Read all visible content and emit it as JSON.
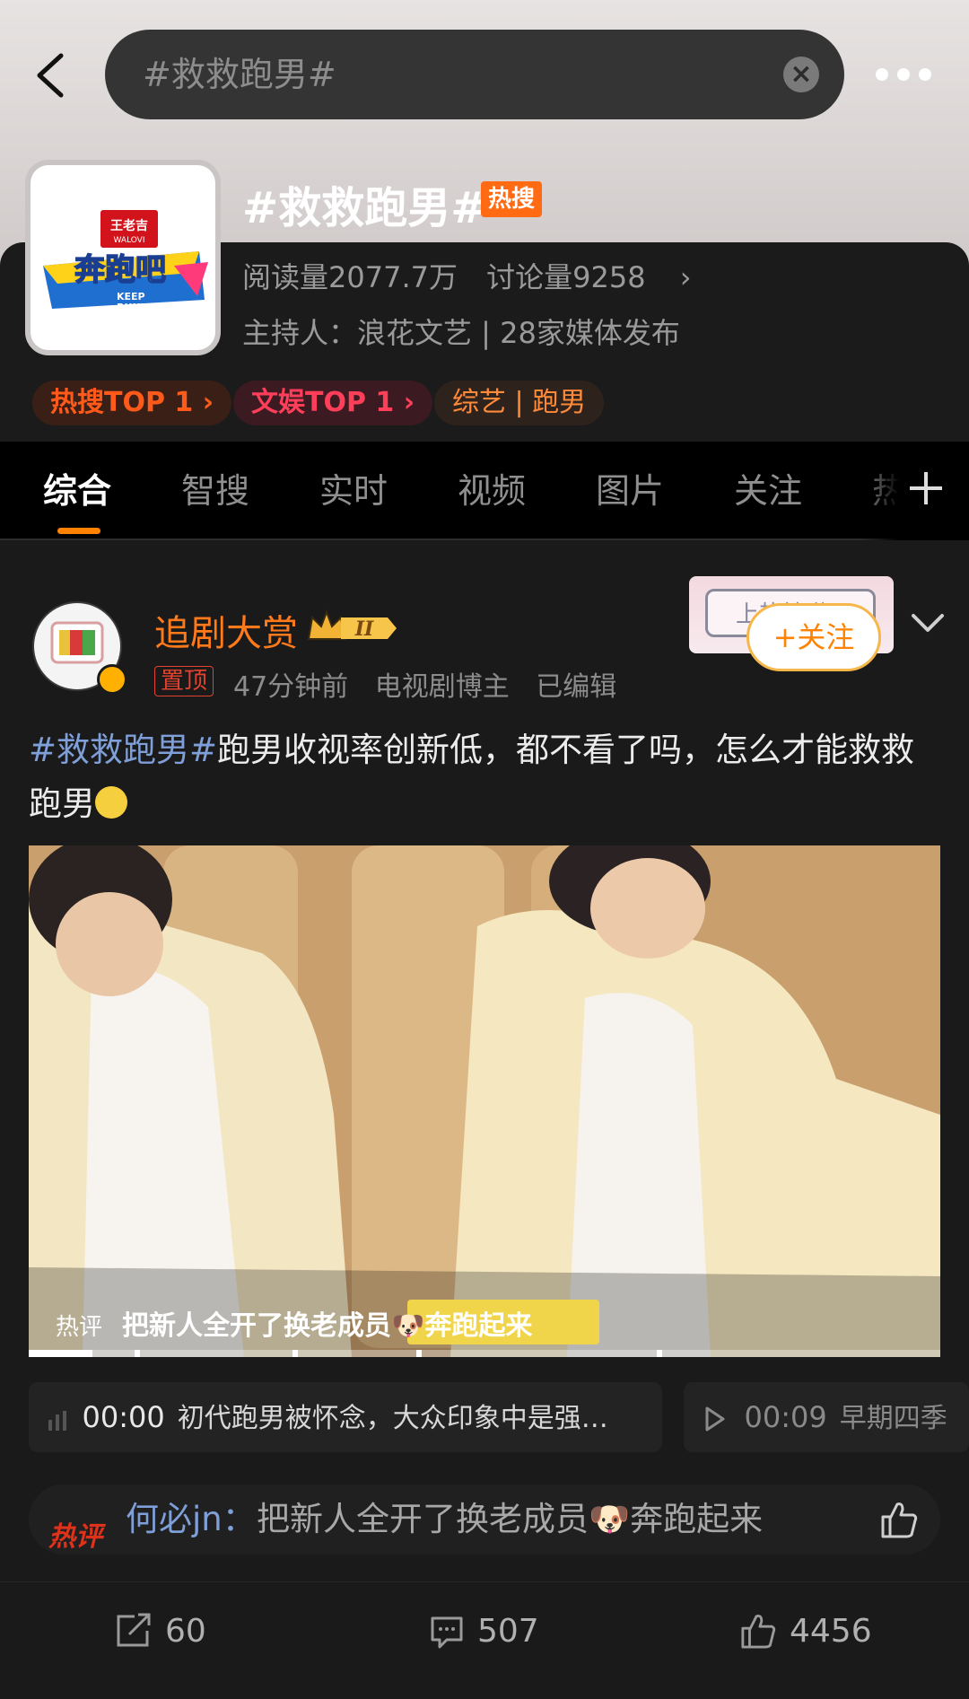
{
  "search": {
    "query": "#救救跑男#"
  },
  "topic": {
    "title": "#救救跑男#",
    "badge": "热搜",
    "reads": "阅读量2077.7万",
    "discussions": "讨论量9258",
    "host": "主持人：浪花文艺 | 28家媒体发布",
    "logo": {
      "top_text": "王老吉",
      "sub_text": "WALOVI",
      "name": "奔跑吧",
      "en1": "KEEP",
      "en2": "RUNNING"
    },
    "chips": [
      {
        "label": "热搜TOP 1 ›",
        "color": "#ff5a1a",
        "bg": "#3a1f17"
      },
      {
        "label": "文娱TOP 1 ›",
        "color": "#ff3e5a",
        "bg": "#3b1a22"
      },
      {
        "label": "综艺 | 跑男",
        "color": "#ff8a3a",
        "bg": "#2e231c"
      }
    ]
  },
  "tabs": [
    {
      "label": "综合",
      "active": true
    },
    {
      "label": "智搜"
    },
    {
      "label": "实时"
    },
    {
      "label": "视频"
    },
    {
      "label": "图片"
    },
    {
      "label": "关注"
    },
    {
      "label": "热"
    }
  ],
  "post": {
    "author": "追剧大赏",
    "vip_level": "II",
    "pinned": "置顶",
    "time": "47分钟前",
    "role": "电视剧博主",
    "edited": "已编辑",
    "follow_label": "+关注",
    "follow_deco_text": "上热搜啦",
    "hashtag": "#救救跑男#",
    "text": "跑男收视率创新低，都不看了吗，怎么才能救救跑男",
    "video": {
      "hot_label": "热评",
      "hot_text": "把新人全开了换老成员🐶奔跑起来",
      "progress": 0.07
    },
    "chapters": [
      {
        "time": "00:00",
        "text": "初代跑男被怀念，大众印象中是强…"
      },
      {
        "time": "00:09",
        "text": "早期四季"
      }
    ],
    "hot_comment": {
      "tag": "热评",
      "user": "何必jn",
      "sep": "：",
      "text": "把新人全开了换老成员🐶奔跑起来"
    },
    "actions": {
      "reposts": "60",
      "comments": "507",
      "likes": "4456"
    }
  }
}
